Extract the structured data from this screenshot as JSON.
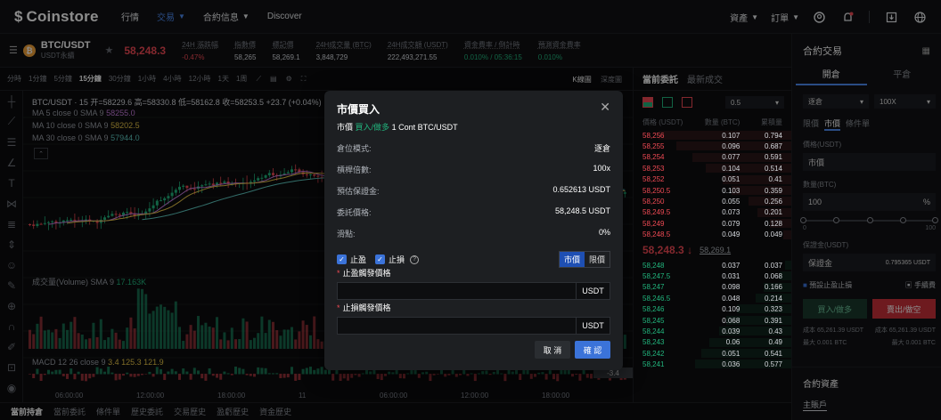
{
  "header": {
    "logo": "Coinstore",
    "nav": [
      {
        "label": "行情",
        "active": false,
        "caret": false
      },
      {
        "label": "交易",
        "active": true,
        "caret": true
      },
      {
        "label": "合約信息",
        "active": false,
        "caret": true
      },
      {
        "label": "Discover",
        "active": false,
        "caret": false
      }
    ],
    "right": {
      "assets": "資產",
      "orders": "訂單"
    }
  },
  "ticker": {
    "pair": "BTC/USDT",
    "sub": "USDT永續",
    "last_price": "58,248.3",
    "stats": [
      {
        "label": "24H 漲跌幅",
        "value": "-0.47%",
        "tone": "red"
      },
      {
        "label": "指數價",
        "value": "58,265",
        "tone": ""
      },
      {
        "label": "標記價",
        "value": "58,269.1",
        "tone": ""
      },
      {
        "label": "24H成交量 (BTC)",
        "value": "3,848,729",
        "tone": ""
      },
      {
        "label": "24H成交額 (USDT)",
        "value": "222,493,271.55",
        "tone": ""
      },
      {
        "label": "資金費率 / 倒計時",
        "value": "0.010% / 05:36:15",
        "tone": "green"
      },
      {
        "label": "預測資金費率",
        "value": "0.010%",
        "tone": "green"
      }
    ]
  },
  "timeframes": [
    "分時",
    "1分鐘",
    "5分鐘",
    "15分鐘",
    "30分鐘",
    "1小時",
    "4小時",
    "12小時",
    "1天",
    "1周"
  ],
  "timeframe_active": "15分鐘",
  "chart_view": {
    "kline": "K線圖",
    "depth": "深度圖"
  },
  "chart": {
    "title": "BTC/USDT · 15",
    "ohlc": "开=58229.6 高=58330.8 低=58162.8 收=58253.5 +23.7 (+0.04%)",
    "ma": [
      {
        "text": "MA 5 close 0 SMA 9",
        "value": "58255.0",
        "color": "#c77dde"
      },
      {
        "text": "MA 10 close 0 SMA 9",
        "value": "58202.5",
        "color": "#e8c547"
      },
      {
        "text": "MA 30 close 0 SMA 9",
        "value": "57944.0",
        "color": "#5ec8c0"
      }
    ],
    "volume_label": "成交量(Volume) SMA 9",
    "volume_value": "17.163K",
    "macd_label": "MACD 12 26 close 9",
    "macd_values": "3.4 125.3 121.9",
    "price_tag": "-3.4",
    "time_labels": [
      "06:00:00",
      "12:00:00",
      "18:00:00",
      "11",
      "06:00:00",
      "12:00:00",
      "18:00:00"
    ]
  },
  "bottom_tabs": [
    "當前持倉",
    "當前委託",
    "條件單",
    "歷史委託",
    "交易歷史",
    "盈虧歷史",
    "資金歷史"
  ],
  "orderbook": {
    "tabs": [
      "當前委託",
      "最新成交"
    ],
    "precision": "0.5",
    "columns": [
      "價格 (USDT)",
      "數量 (BTC)",
      "累積量"
    ],
    "asks": [
      [
        "58,256",
        "0.107",
        "0.794"
      ],
      [
        "58,255",
        "0.096",
        "0.687"
      ],
      [
        "58,254",
        "0.077",
        "0.591"
      ],
      [
        "58,253",
        "0.104",
        "0.514"
      ],
      [
        "58,252",
        "0.051",
        "0.41"
      ],
      [
        "58,250.5",
        "0.103",
        "0.359"
      ],
      [
        "58,250",
        "0.055",
        "0.256"
      ],
      [
        "58,249.5",
        "0.073",
        "0.201"
      ],
      [
        "58,249",
        "0.079",
        "0.128"
      ],
      [
        "58,248.5",
        "0.049",
        "0.049"
      ]
    ],
    "mid_price": "58,248.3",
    "mid_arrow": "↓",
    "mid_ref": "58,269.1",
    "bids": [
      [
        "58,248",
        "0.037",
        "0.037"
      ],
      [
        "58,247.5",
        "0.031",
        "0.068"
      ],
      [
        "58,247",
        "0.098",
        "0.166"
      ],
      [
        "58,246.5",
        "0.048",
        "0.214"
      ],
      [
        "58,246",
        "0.109",
        "0.323"
      ],
      [
        "58,245",
        "0.068",
        "0.391"
      ],
      [
        "58,244",
        "0.039",
        "0.43"
      ],
      [
        "58,243",
        "0.06",
        "0.49"
      ],
      [
        "58,242",
        "0.051",
        "0.541"
      ],
      [
        "58,241",
        "0.036",
        "0.577"
      ]
    ]
  },
  "trade_panel": {
    "title": "合約交易",
    "tabs": [
      "開倉",
      "平倉"
    ],
    "margin_mode": "逐倉",
    "leverage": "100X",
    "order_types": [
      "限價",
      "市價",
      "條件單"
    ],
    "price_label": "價格(USDT)",
    "price_value": "市價",
    "qty_label": "數量(BTC)",
    "qty_value": "100",
    "qty_unit": "%",
    "slider_labels": [
      "0",
      "100"
    ],
    "margin_label": "保證金(USDT)",
    "margin_select": "保證金",
    "margin_value": "0.795365 USDT",
    "tpsl_check": "預設止盈止損",
    "manual": "手續費",
    "buy": "買入/做多",
    "sell": "賣出/做空",
    "cost_buy": "成本 65,261.39 USDT",
    "cost_sell": "成本 65,261.39 USDT",
    "max_buy": "最大 0.001 BTC",
    "max_sell": "最大 0.001 BTC",
    "assets_title": "合約資產",
    "assets_account": "主賬戶"
  },
  "modal": {
    "title": "市價買入",
    "subtitle_prefix": "市價",
    "subtitle_side": "買入/做多",
    "subtitle_qty": "1 Cont BTC/USDT",
    "rows": [
      {
        "k": "倉位模式:",
        "v": "逐倉"
      },
      {
        "k": "槓桿倍數:",
        "v": "100x"
      },
      {
        "k": "預估保證金:",
        "v": "0.652613 USDT"
      },
      {
        "k": "委託價格:",
        "v": "58,248.5 USDT"
      },
      {
        "k": "滑點:",
        "v": "0%"
      }
    ],
    "take_profit": "止盈",
    "stop_loss": "止損",
    "toggle": [
      "市價",
      "限價"
    ],
    "tp_label": "止盈觸發價格",
    "sl_label": "止損觸發價格",
    "unit": "USDT",
    "cancel": "取 消",
    "confirm": "確 認"
  }
}
